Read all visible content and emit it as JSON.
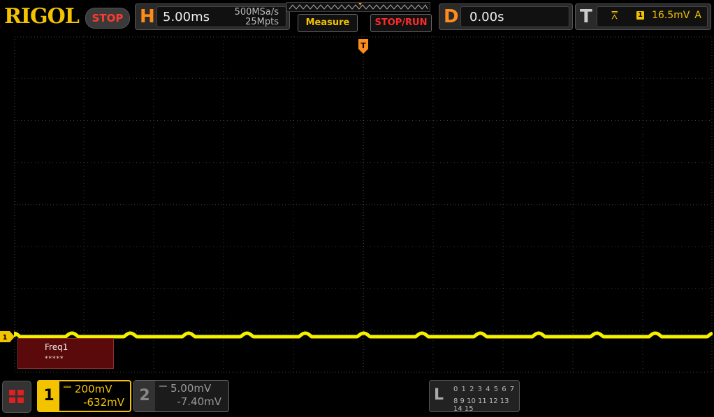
{
  "brand": {
    "logo": "RIGOL",
    "run_state": "STOP"
  },
  "horizontal": {
    "letter": "H",
    "timebase": "5.00ms",
    "sample_rate": "500MSa/s",
    "memory_depth": "25Mpts"
  },
  "buttons": {
    "measure": "Measure",
    "stop_run": "STOP/RUN"
  },
  "delay": {
    "letter": "D",
    "value": "0.00s"
  },
  "trigger": {
    "letter": "T",
    "source": "1",
    "level": "16.5mV",
    "mode": "A",
    "marker": "T"
  },
  "measurement": {
    "name": "Freq1",
    "value": "*****"
  },
  "channel1": {
    "number": "1",
    "marker": "1",
    "coupling": "DC",
    "scale": "200mV",
    "offset": "-632mV",
    "color": "#f3c300"
  },
  "channel2": {
    "number": "2",
    "coupling": "DC",
    "scale": "5.00mV",
    "offset": "-7.40mV"
  },
  "logic": {
    "letter": "L",
    "row1": "0 1 2 3   4 5 6 7",
    "row2": "8 9 10 11 12 13 14 15"
  },
  "colors": {
    "accent": "#f3c300",
    "stop": "#ff3b2f",
    "panel_letter": "#ff8c1a"
  }
}
